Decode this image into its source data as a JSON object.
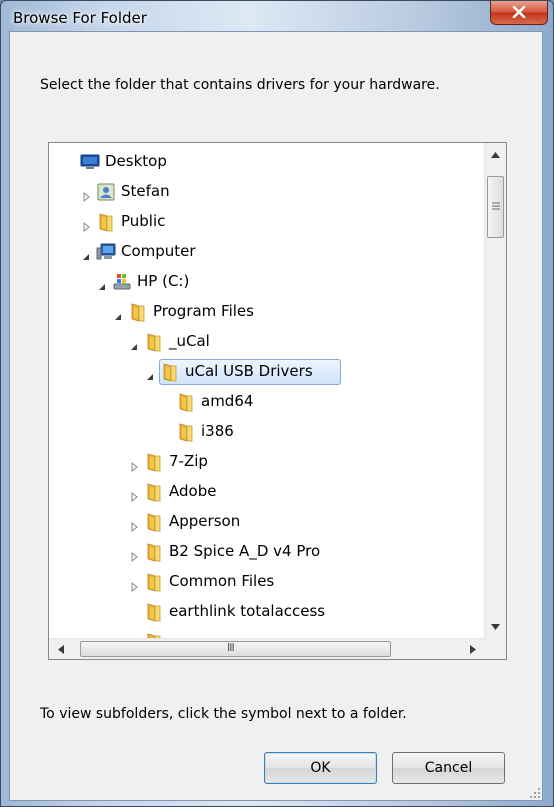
{
  "window": {
    "title": "Browse For Folder",
    "close_glyph": "X"
  },
  "description": "Select the folder that contains drivers for your hardware.",
  "tree": {
    "rows": [
      {
        "label": "Desktop",
        "icon": "desktop-icon",
        "expander": "none",
        "selected": false
      },
      {
        "label": "Stefan",
        "icon": "user-folder-icon",
        "expander": "collapsed",
        "selected": false
      },
      {
        "label": "Public",
        "icon": "folder-icon",
        "expander": "collapsed",
        "selected": false
      },
      {
        "label": "Computer",
        "icon": "computer-icon",
        "expander": "expanded",
        "selected": false
      },
      {
        "label": "HP (C:)",
        "icon": "drive-icon",
        "expander": "expanded",
        "selected": false
      },
      {
        "label": "Program Files",
        "icon": "folder-icon",
        "expander": "expanded",
        "selected": false
      },
      {
        "label": "_uCal",
        "icon": "folder-icon",
        "expander": "expanded",
        "selected": false
      },
      {
        "label": "uCal USB Drivers",
        "icon": "folder-icon",
        "expander": "expanded",
        "selected": true
      },
      {
        "label": "amd64",
        "icon": "folder-icon",
        "expander": "none",
        "selected": false
      },
      {
        "label": "i386",
        "icon": "folder-icon",
        "expander": "none",
        "selected": false
      },
      {
        "label": "7-Zip",
        "icon": "folder-icon",
        "expander": "collapsed",
        "selected": false
      },
      {
        "label": "Adobe",
        "icon": "folder-icon",
        "expander": "collapsed",
        "selected": false
      },
      {
        "label": "Apperson",
        "icon": "folder-icon",
        "expander": "collapsed",
        "selected": false
      },
      {
        "label": "B2 Spice A_D v4 Pro",
        "icon": "folder-icon",
        "expander": "collapsed",
        "selected": false
      },
      {
        "label": "Common Files",
        "icon": "folder-icon",
        "expander": "collapsed",
        "selected": false
      },
      {
        "label": "earthlink totalaccess",
        "icon": "folder-icon",
        "expander": "none",
        "selected": false
      },
      {
        "label": "",
        "icon": "folder-icon",
        "expander": "none",
        "selected": false
      }
    ],
    "hscroll_grip": "III"
  },
  "hint": "To view subfolders, click the symbol next to a folder.",
  "buttons": {
    "ok": "OK",
    "cancel": "Cancel"
  },
  "colors": {
    "selection_border": "#84acdd",
    "selection_fill": "#cfe4fa",
    "folder": "#f2c84b",
    "close_button": "#c2341b"
  }
}
